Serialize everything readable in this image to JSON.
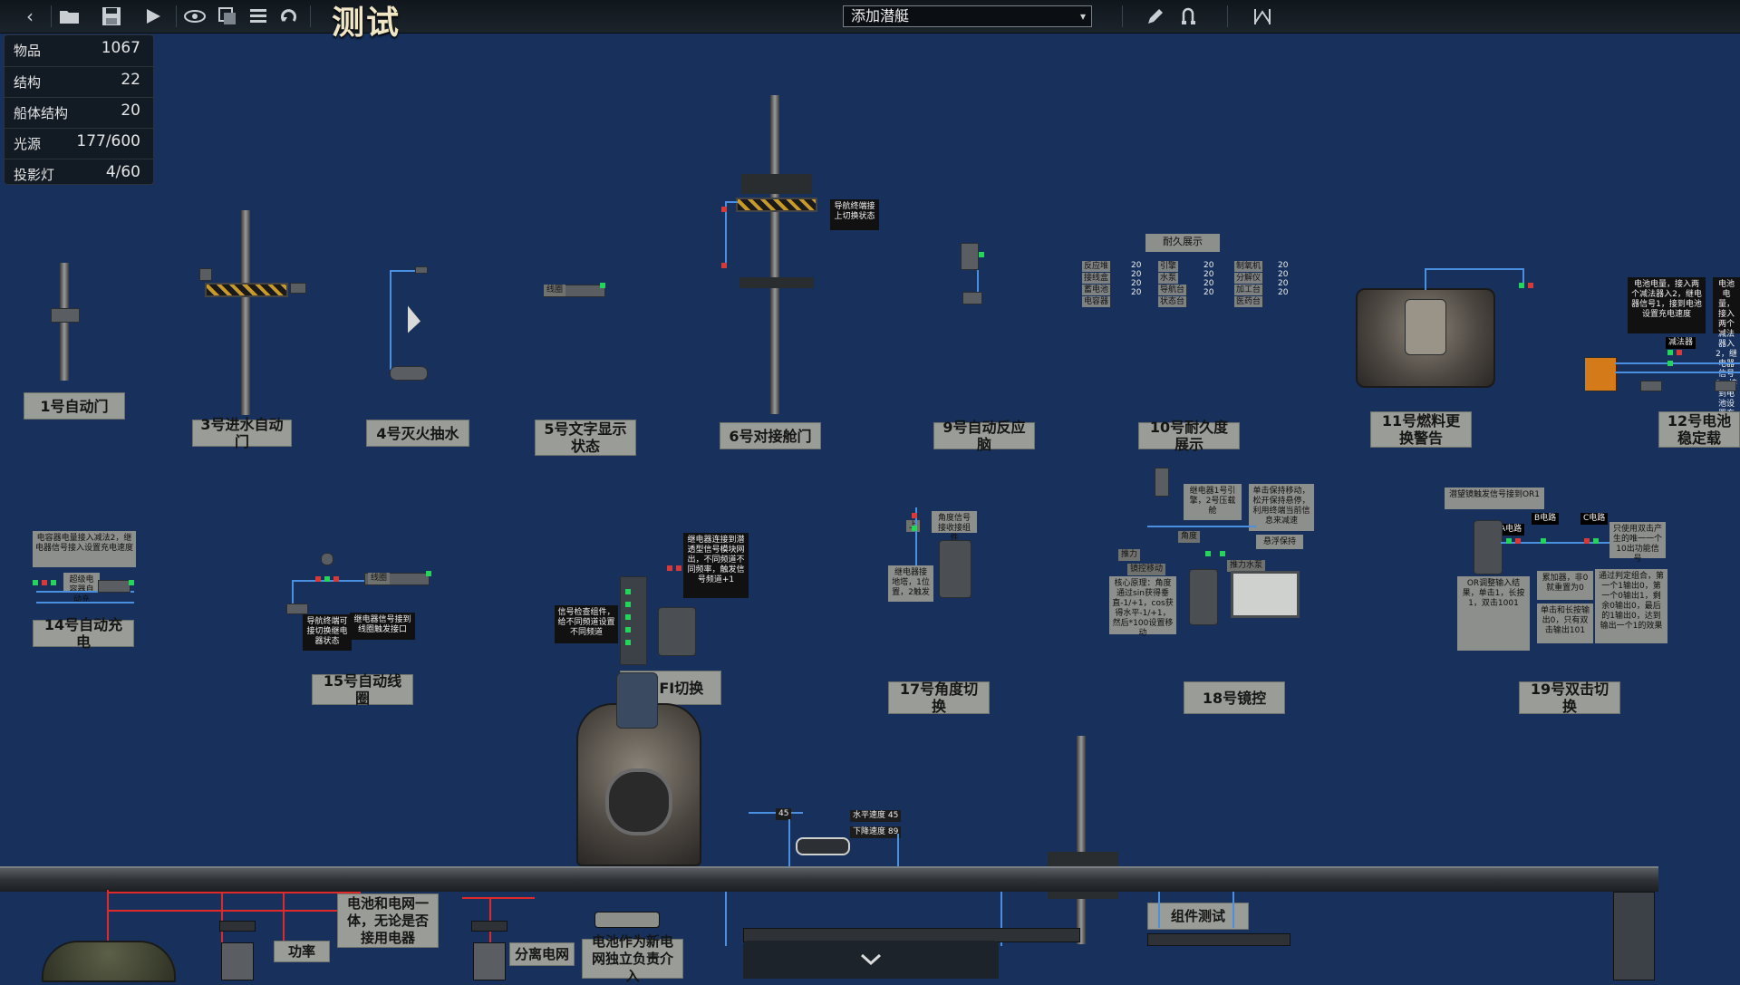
{
  "toolbar": {
    "back_icon": "chevron-left-icon",
    "open_icon": "folder-open-icon",
    "save_icon": "floppy-save-icon",
    "play_icon": "play-icon",
    "submarine_title": "测试",
    "submarine_select": "添加潜艇"
  },
  "stats": [
    {
      "label": "物品",
      "value": "1067"
    },
    {
      "label": "结构",
      "value": "22"
    },
    {
      "label": "船体结构",
      "value": "20"
    },
    {
      "label": "光源",
      "value": "177/600"
    },
    {
      "label": "投影灯",
      "value": "4/60"
    }
  ],
  "labels": {
    "l1": "1号自动门",
    "l3": "3号进水自动门",
    "l4": "4号灭火抽水",
    "l5": "5号文字显示状态",
    "l6": "6号对接舱门",
    "l9": "9号自动反应脑",
    "l10": "10号耐久度展示",
    "l11": "11号燃料更换警告",
    "l12": "12号电池稳定载",
    "l14": "14号自动充电",
    "l15": "15号自动线圈",
    "l16": "WIFI切换",
    "l17": "17号角度切换",
    "l18": "18号镜控",
    "l19": "19号双击切换",
    "bottom1": "电池和电网一体，无论是否接用电器",
    "bottom2": "功率",
    "bottom3": "分离电网",
    "bottom4": "电池作为新电网独立负责介入",
    "bottom5": "组件测试"
  },
  "notes": {
    "n6": "导航终端接上切换状态",
    "n10_title": "耐久展示",
    "n12": "电池电量，接入两个减法器入2，继电器信号1，接到电池设置充电速度",
    "n12b": "减法器",
    "n14": "电容器电量接入减法2，继电器信号接入设置充电速度",
    "n14b": "超级电容器自动充",
    "n15a": "导航终端可接切换继电器状态",
    "n15b": "继电器信号接到线圈触发接口",
    "n15c": "线圈",
    "n5": "线圈",
    "n16a": "继电器连接到潜透型信号模块网出，不同频道不同频率，触发信号频道+1",
    "n16b": "信号检查组件，给不同频道设置不同频道",
    "n17a": "角度信号接收接组件",
    "n17b": "继电器接地塔，1位置，2触发",
    "n17c": "上",
    "n18a": "继电器1号引擎，2号压载舱",
    "n18b": "单击保持移动，松开保持悬停，利用终端当前信息来减速",
    "n18c": "悬浮保持",
    "n18d": "推力",
    "n18e": "核心原理：角度通过sin获得垂直-1/+1，cos获得水平-1/+1，然后*100设置移动",
    "n18f": "角度",
    "n18g": "镜控移动",
    "n18h": "推力水泵",
    "n19a": "潜望镜触发信号接到OR1",
    "n19b": "OR调整输入结果，单击1，长按1，双击1001",
    "n19c": "累加器，非0就重置为0",
    "n19d": "单击和长按输出0，只有双击输出101",
    "n19e": "只使用双击产生的唯一一个10出功能信号",
    "n19f": "通过判定组合，第一个1输出0，第一个0输出1，剩余0输出0，最后的1输出0，达到输出一个1的效果",
    "n19g": "B电路",
    "n19h": "C电路",
    "n19i": "A电路",
    "n_bottom1": "45",
    "n_bottom2": "水平速度 45",
    "n_bottom3": "下降速度 89"
  },
  "durability_table": {
    "col1": [
      "反应堆",
      "接线盒",
      "蓄电池",
      "电容器"
    ],
    "col2": [
      "20",
      "20",
      "20",
      "20"
    ],
    "col3": [
      "引擎",
      "水泵",
      "导航台",
      "状态台"
    ],
    "col4": [
      "20",
      "20",
      "20",
      "20"
    ],
    "col5": [
      "制氧机",
      "分解仪",
      "加工台",
      "医药台"
    ],
    "col6": [
      "20",
      "20",
      "20",
      "20"
    ]
  },
  "bottom_tab_icon": "chevron-down-icon"
}
